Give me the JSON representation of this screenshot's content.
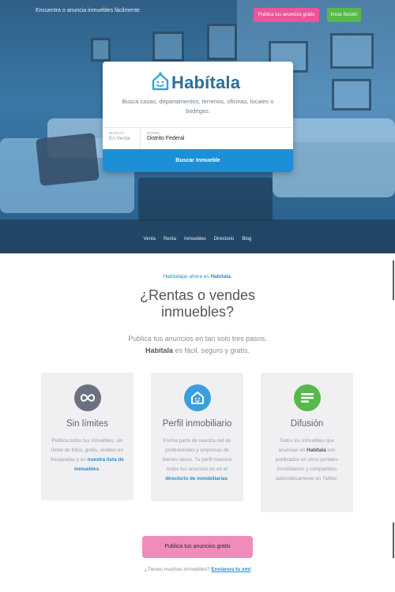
{
  "hero": {
    "tagline_top": "Encuentra o anuncia inmuebles fácilmente",
    "publish_button": "Publica tus anuncios gratis",
    "login_button": "Inicia Sesión",
    "colors": {
      "pink": "#e9569a",
      "green": "#56b94a",
      "blue": "#1c8fd6"
    }
  },
  "search_card": {
    "logo_text": "Habítala",
    "tagline": "Busca casas, departamentos, terrenos, oficinas, locales o bodegas.",
    "field_type_label": "Buscas",
    "field_type_value": "En Venta",
    "field_location_label": "Dónde",
    "field_location_value": "Distrito Federal",
    "search_button": "Buscar Inmueble"
  },
  "nav": {
    "items": [
      "Venta",
      "Renta",
      "Inmuebles",
      "Directorio",
      "Blog"
    ]
  },
  "intro": {
    "kicker_prefix": "Habitalapp ahora es",
    "kicker_brand": "Habítala.",
    "headline_line1": "¿Rentas o vendes",
    "headline_line2": "inmuebles?",
    "sub_line1": "Publica tus anuncios en tan solo tres pasos.",
    "sub_brand": "Habítala",
    "sub_line2_rest": "es fácil, seguro y gratis."
  },
  "features": [
    {
      "icon": "infinity-icon",
      "color": "#6b7180",
      "title": "Sin límites",
      "body": "Publica todos tus inmuebles, sin límite de fotos, gratis, visibles en búsquedas y en",
      "link": "nuestra lista de inmuebles",
      "after": "."
    },
    {
      "icon": "house-icon",
      "color": "#3aa0dc",
      "title": "Perfil inmobiliario",
      "body": "Forma parte de nuestra red de profesionales y empresas de bienes raices. Tu perfil muestra todos tus anuncios en en el",
      "link": "directorio de inmobiliarias",
      "after": "."
    },
    {
      "icon": "message-icon",
      "color": "#56b94a",
      "title": "Difusión",
      "body_before": "Todos los inmuebles que anuncias en",
      "brand": "Habítala",
      "body_after": "son publicados en otros portales inmobiliarios y compartidos automáticamente en Twitter."
    }
  ],
  "cta": {
    "button": "Publica tus anuncios gratis",
    "question": "¿Tienes muchos inmuebles?",
    "link": "Envíanos tu xml"
  }
}
